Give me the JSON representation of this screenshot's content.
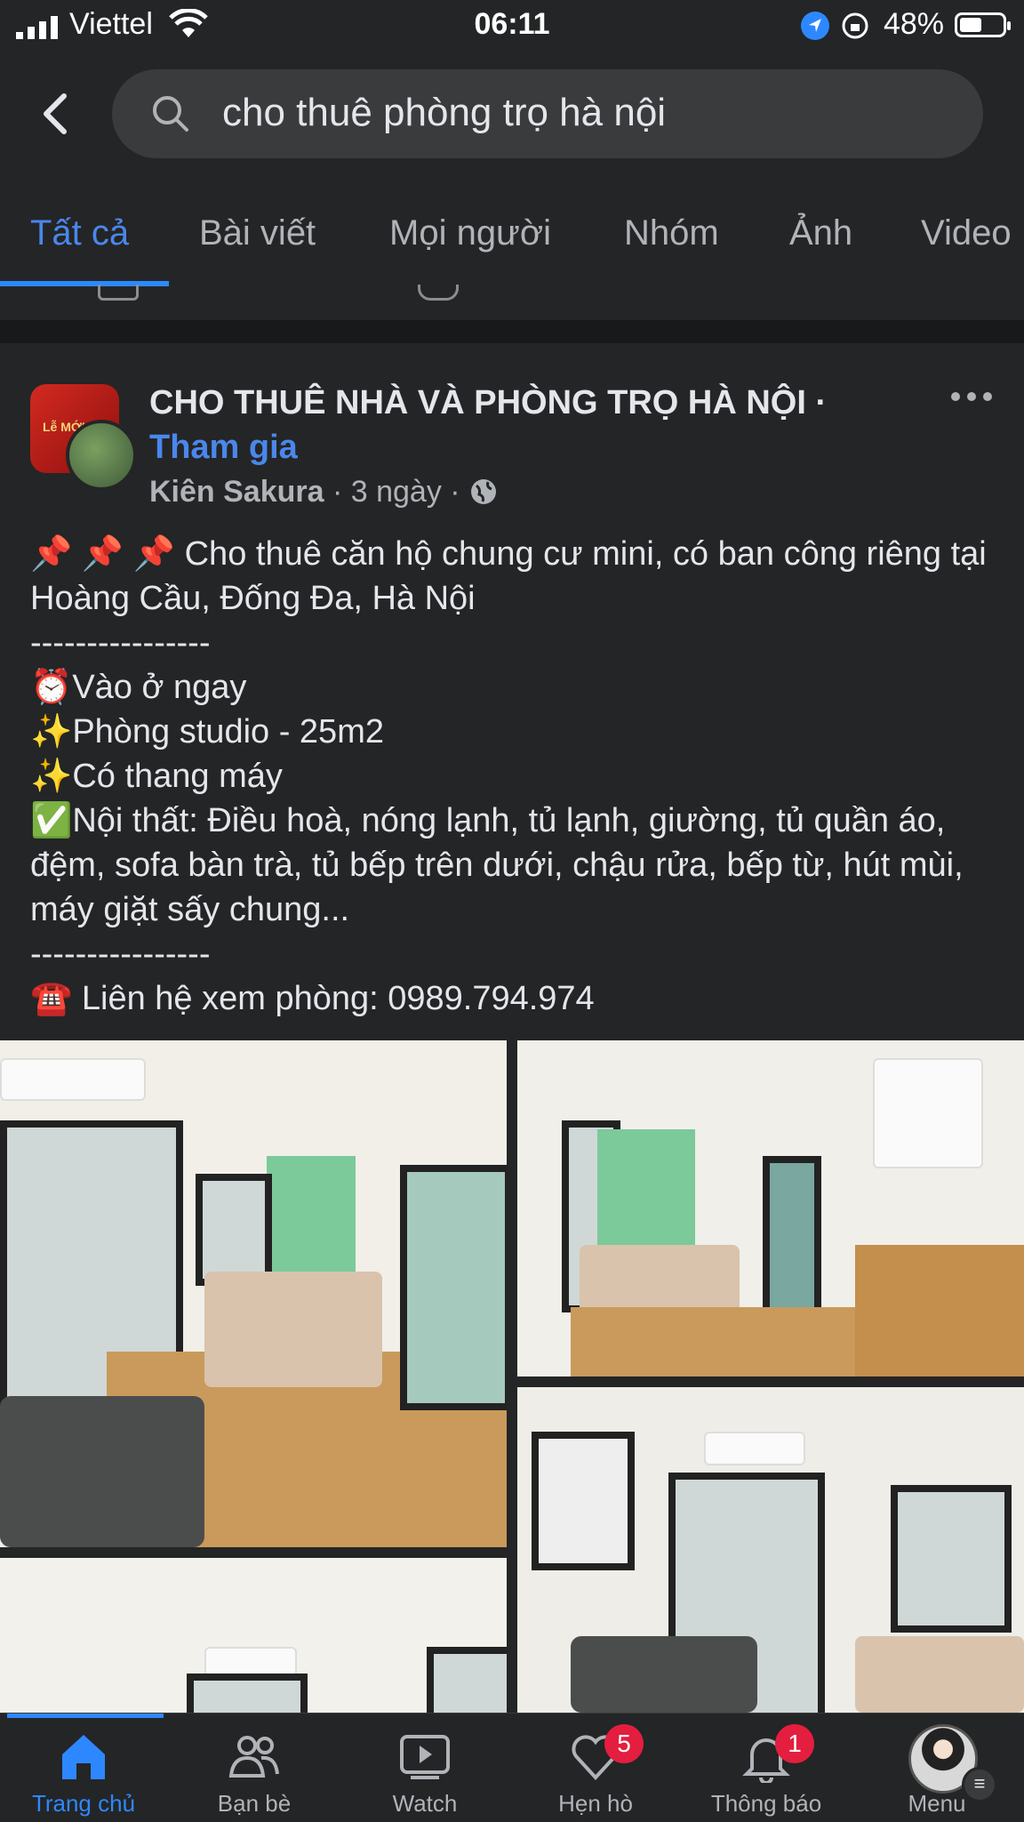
{
  "status_bar": {
    "carrier": "Viettel",
    "time": "06:11",
    "battery": "48%"
  },
  "search": {
    "query": "cho thuê phòng trọ hà nội"
  },
  "tabs": [
    {
      "label": "Tất cả",
      "active": true
    },
    {
      "label": "Bài viết"
    },
    {
      "label": "Mọi người"
    },
    {
      "label": "Nhóm"
    },
    {
      "label": "Ảnh"
    },
    {
      "label": "Video"
    }
  ],
  "post": {
    "group_name": "CHO THUÊ NHÀ VÀ PHÒNG TRỌ HÀ NỘI ·",
    "join_label": "Tham gia",
    "author": "Kiên Sakura",
    "time": "· 3 ngày ·",
    "lines": [
      "📌 📌 📌 Cho thuê căn hộ chung cư mini, có ban công riêng tại Hoàng Cầu, Đống Đa, Hà Nội",
      "----------------",
      "⏰Vào ở ngay",
      "✨Phòng studio - 25m2",
      "✨Có thang máy",
      "✅Nội thất: Điều hoà, nóng lạnh, tủ lạnh, giường, tủ quần áo, đệm, sofa bàn trà, tủ bếp trên dưới, chậu rửa, bếp từ, hút mùi, máy giặt sấy chung...",
      "----------------",
      "☎️ Liên hệ xem phòng: 0989.794.974"
    ]
  },
  "bottom_nav": [
    {
      "label": "Trang chủ",
      "icon": "home-icon",
      "active": true
    },
    {
      "label": "Bạn bè",
      "icon": "friends-icon"
    },
    {
      "label": "Watch",
      "icon": "watch-icon"
    },
    {
      "label": "Hẹn hò",
      "icon": "dating-icon",
      "badge": "5"
    },
    {
      "label": "Thông báo",
      "icon": "bell-icon",
      "badge": "1"
    },
    {
      "label": "Menu",
      "icon": "profile-avatar"
    }
  ],
  "colors": {
    "background": "#242526",
    "accent": "#2d88ff",
    "badge": "#e41e3f"
  }
}
